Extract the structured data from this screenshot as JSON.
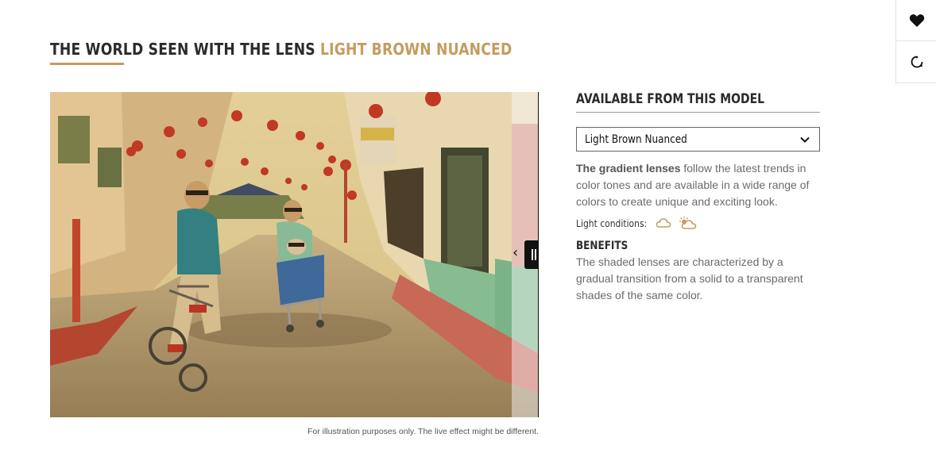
{
  "heading": {
    "prefix": "THE WORLD SEEN WITH THE LENS",
    "lens_name": "LIGHT BROWN NUANCED"
  },
  "side_actions": [
    {
      "icon": "heart-icon"
    },
    {
      "icon": "rotate-360-icon"
    }
  ],
  "viewer": {
    "scene": "street-with-lanterns-bicycle",
    "caption": "For illustration purposes only. The live effect might be different."
  },
  "panel": {
    "title": "AVAILABLE FROM THIS MODEL",
    "select": {
      "value": "Light Brown Nuanced",
      "icon": "chevron-down-icon"
    },
    "description": {
      "bold": "The gradient lenses",
      "rest": " follow the latest trends in color tones and are available in a wide range of colors to create unique and exciting look."
    },
    "light_conditions": {
      "label": "Light conditions:",
      "icons": [
        "cloud-icon",
        "sun-cloud-icon"
      ]
    },
    "benefits": {
      "title": "BENEFITS",
      "text": "The shaded lenses are characterized by a gradual transition from a solid to a transparent shades of the same color."
    }
  },
  "colors": {
    "accent": "#c59b5f",
    "text_dark": "#2b2b2b",
    "text_muted": "#6b6b6b"
  }
}
